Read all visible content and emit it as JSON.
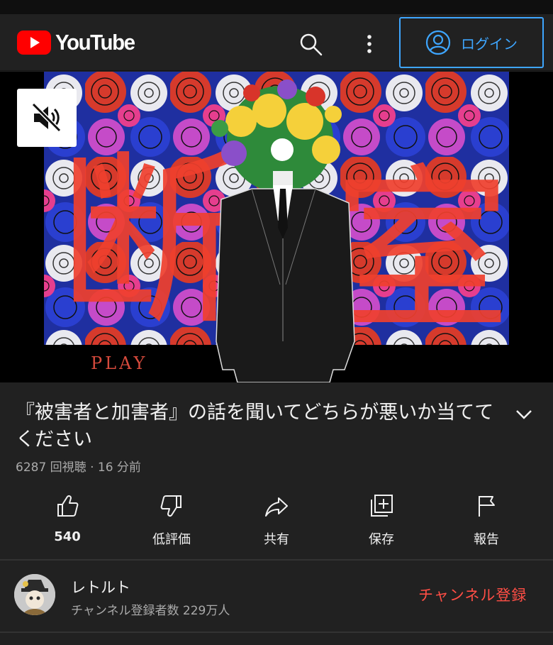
{
  "header": {
    "logo_text": "YouTube",
    "login_label": "ログイン"
  },
  "video": {
    "thumbnail_text_left": "断",
    "thumbnail_text_right": "室",
    "thumbnail_play_text": "PLAY",
    "title": "『被害者と加害者』の話を聞いてどちらが悪いか当ててください",
    "meta": "6287 回視聴 · 16 分前"
  },
  "actions": [
    {
      "label": "540",
      "icon": "thumbs-up-icon"
    },
    {
      "label": "低評価",
      "icon": "thumbs-down-icon"
    },
    {
      "label": "共有",
      "icon": "share-icon"
    },
    {
      "label": "保存",
      "icon": "save-playlist-icon"
    },
    {
      "label": "報告",
      "icon": "flag-icon"
    }
  ],
  "channel": {
    "name": "レトルト",
    "subscribers": "チャンネル登録者数 229万人",
    "subscribe_label": "チャンネル登録"
  },
  "colors": {
    "background": "#212121",
    "accent_blue": "#3ea6ff",
    "subscribe_red": "#ff4e45",
    "logo_red": "#ff0000",
    "secondary_text": "#aaaaaa"
  }
}
